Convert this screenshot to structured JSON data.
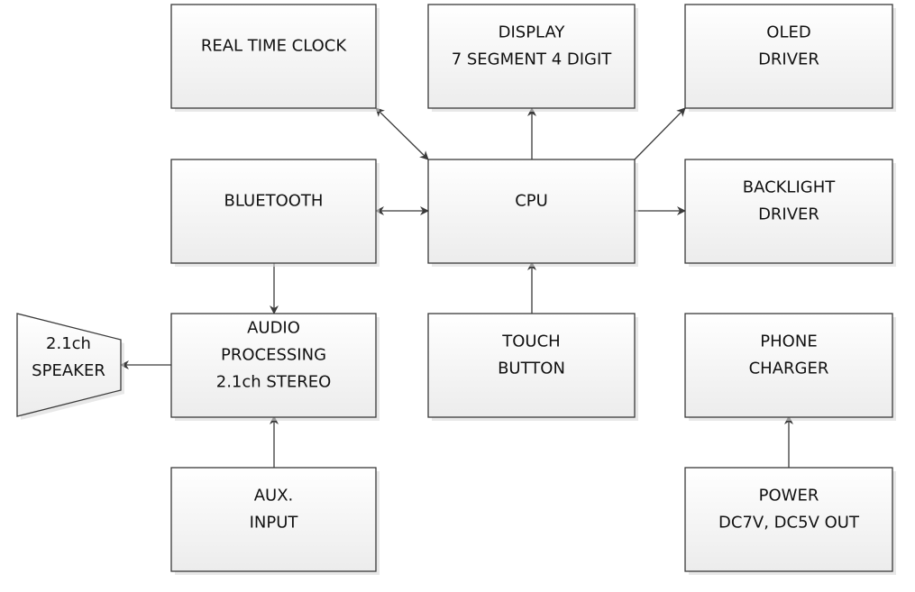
{
  "blocks": {
    "rtc": [
      "REAL TIME CLOCK"
    ],
    "display": [
      "DISPLAY",
      "7 SEGMENT 4 DIGIT"
    ],
    "oled": [
      "OLED",
      "DRIVER"
    ],
    "bluetooth": [
      "BLUETOOTH"
    ],
    "cpu": [
      "CPU"
    ],
    "backlight": [
      "BACKLIGHT",
      "DRIVER"
    ],
    "audio": [
      "AUDIO",
      "PROCESSING",
      "2.1ch STEREO"
    ],
    "touch": [
      "TOUCH",
      "BUTTON"
    ],
    "charger": [
      "PHONE",
      "CHARGER"
    ],
    "aux": [
      "AUX.",
      "INPUT"
    ],
    "power": [
      "POWER",
      "DC7V, DC5V OUT"
    ],
    "speaker": [
      "2.1ch",
      "SPEAKER"
    ]
  },
  "connections": [
    {
      "from": "rtc",
      "to": "cpu",
      "bidirectional": true
    },
    {
      "from": "cpu",
      "to": "display"
    },
    {
      "from": "cpu",
      "to": "oled"
    },
    {
      "from": "bluetooth",
      "to": "cpu",
      "bidirectional": true
    },
    {
      "from": "cpu",
      "to": "backlight"
    },
    {
      "from": "touch",
      "to": "cpu"
    },
    {
      "from": "bluetooth",
      "to": "audio"
    },
    {
      "from": "aux",
      "to": "audio"
    },
    {
      "from": "audio",
      "to": "speaker"
    },
    {
      "from": "power",
      "to": "charger"
    }
  ],
  "colors": {
    "stroke": "#3a3a3a",
    "fill_top": "#ffffff",
    "fill_bottom": "#ececec",
    "shadow": "#d8d8d8"
  }
}
